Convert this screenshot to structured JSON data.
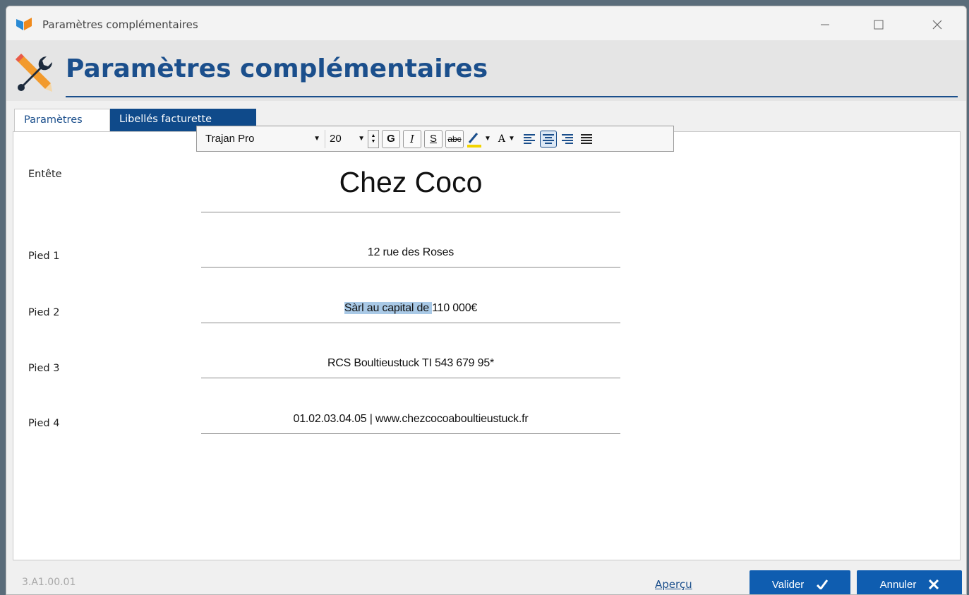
{
  "window": {
    "title": "Paramètres complémentaires"
  },
  "header": {
    "title": "Paramètres complémentaires"
  },
  "tabs": [
    {
      "label": "Paramètres",
      "active": false
    },
    {
      "label": "Libellés facturette",
      "active": true
    }
  ],
  "form": {
    "entete_label": "Entête",
    "entete_value": "Chez Coco",
    "pied1_label": "Pied 1",
    "pied1_value": "12 rue des Roses",
    "pied2_label": "Pied 2",
    "pied2_selected": "Sàrl au capital de ",
    "pied2_rest": "110 000€",
    "pied3_label": "Pied 3",
    "pied3_value": "RCS Boultieustuck TI 543 679 95*",
    "pied4_label": "Pied 4",
    "pied4_value": "01.02.03.04.05 | www.chezcocoaboultieustuck.fr"
  },
  "toolbar": {
    "font": "Trajan Pro",
    "size": "20",
    "bold": "G",
    "italic": "I",
    "underline": "S",
    "strike": "abc",
    "font_color": "A",
    "active_alignment": "center",
    "highlight_color": "#f2d400"
  },
  "footer": {
    "version": "3.A1.00.01",
    "apercu": "Aperçu",
    "valider": "Valider",
    "annuler": "Annuler"
  },
  "colors": {
    "accent": "#1b4f8c",
    "button": "#0f5db0",
    "selection": "#a9c9e6"
  }
}
